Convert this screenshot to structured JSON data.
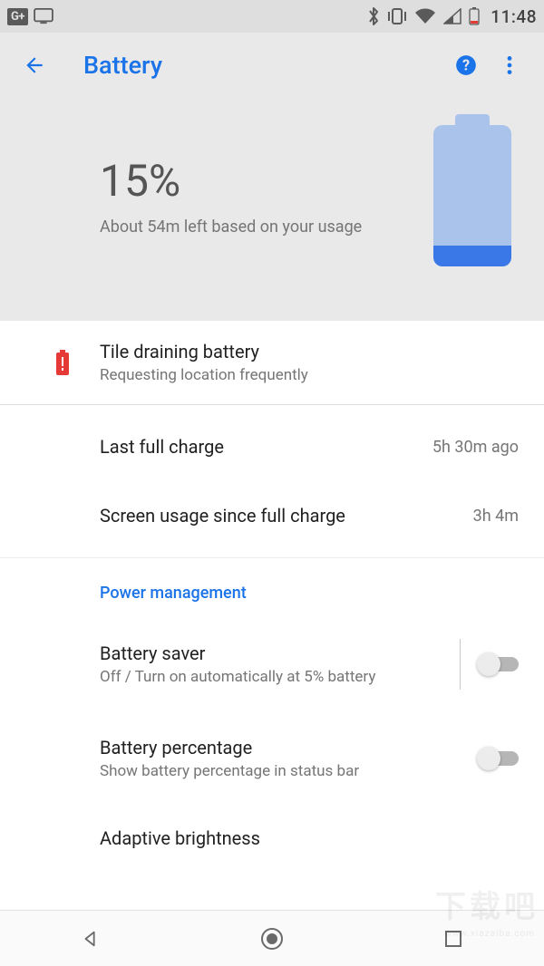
{
  "statusbar": {
    "gplus": "G+",
    "clock": "11:48"
  },
  "header": {
    "title": "Battery"
  },
  "hero": {
    "percent": "15%",
    "subtitle": "About 54m left based on your usage",
    "fill_percent": 15
  },
  "alert": {
    "title": "Tile draining battery",
    "subtitle": "Requesting location frequently"
  },
  "stats": [
    {
      "label": "Last full charge",
      "value": "5h 30m ago"
    },
    {
      "label": "Screen usage since full charge",
      "value": "3h 4m"
    }
  ],
  "section_label": "Power management",
  "settings": {
    "battery_saver": {
      "title": "Battery saver",
      "subtitle": "Off / Turn on automatically at 5% battery",
      "on": false
    },
    "battery_percentage": {
      "title": "Battery percentage",
      "subtitle": "Show battery percentage in status bar",
      "on": false
    },
    "adaptive_brightness": {
      "title": "Adaptive brightness"
    }
  },
  "watermark": {
    "big": "下载吧",
    "small": "www.xiazaiba.com"
  }
}
